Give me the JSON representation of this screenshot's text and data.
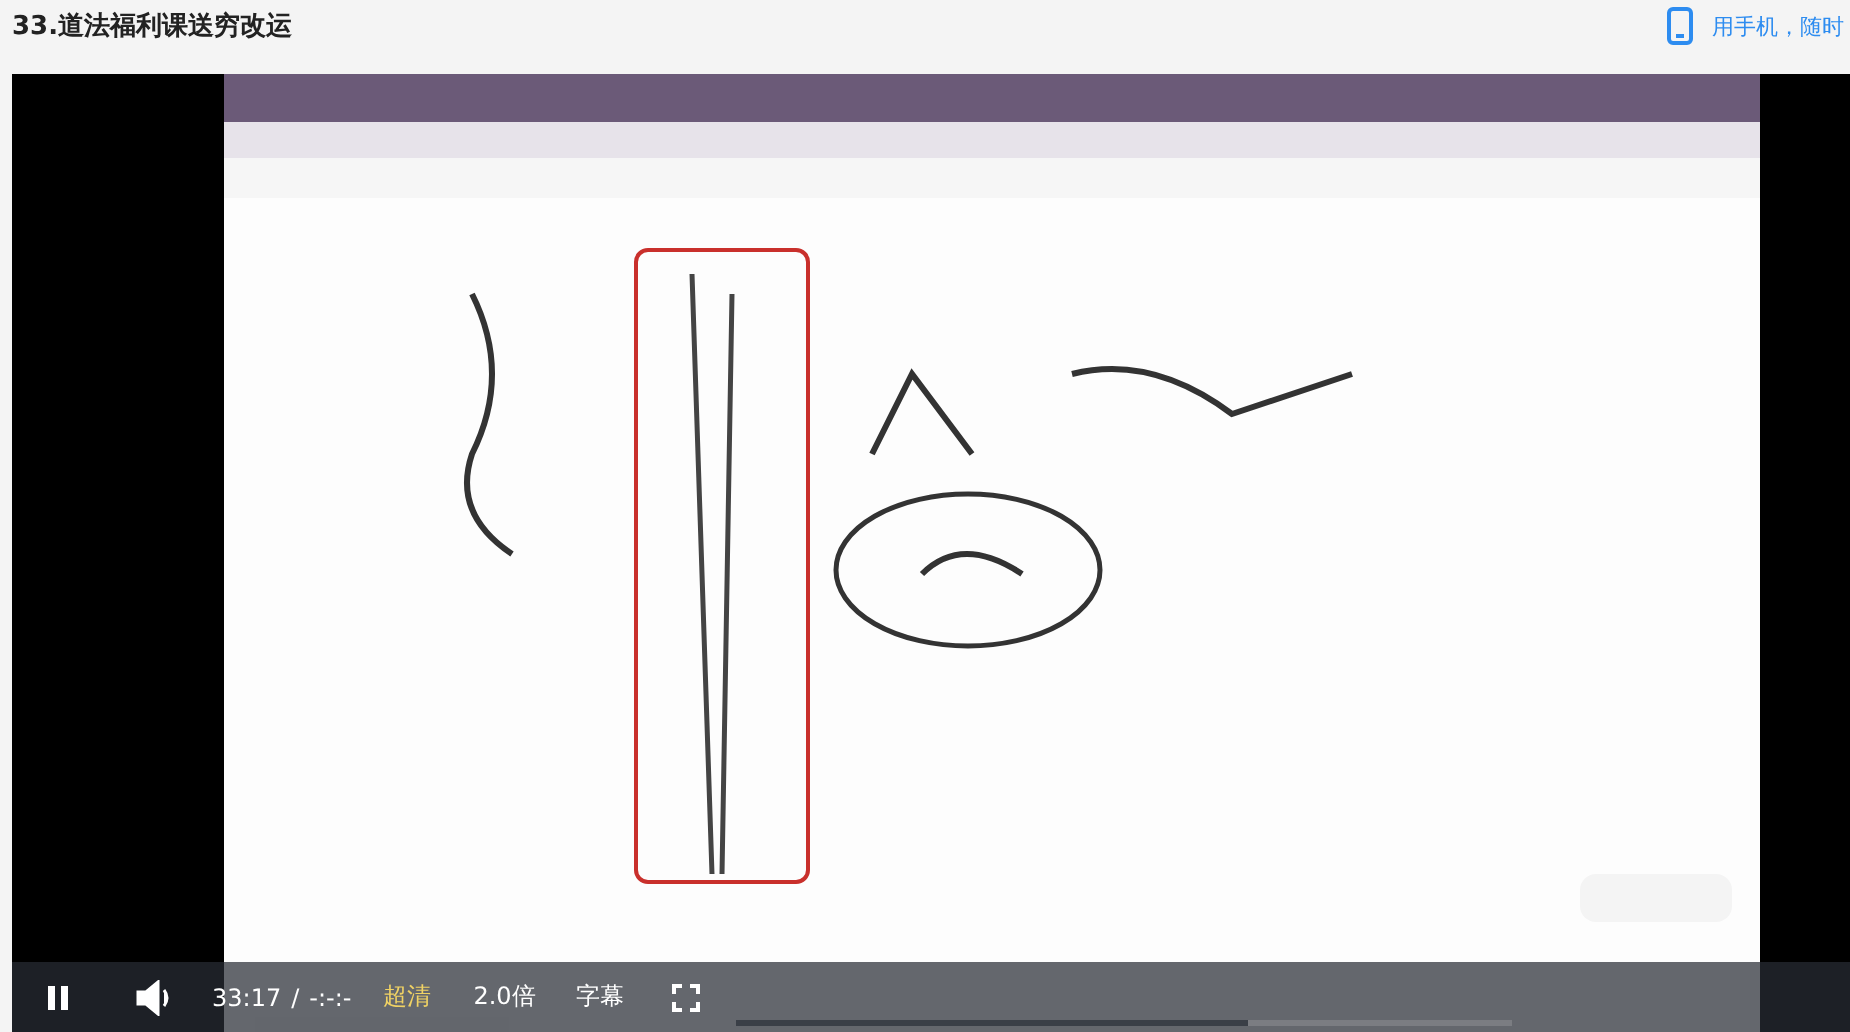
{
  "page": {
    "title": "33.道法福利课送穷改运",
    "mobile_link": "用手机，随时"
  },
  "player": {
    "playing": true,
    "time": "33:17",
    "separator": "/",
    "duration": "-:-:-",
    "quality": "超清",
    "speed": "2.0倍",
    "subtitles": "字幕",
    "progress": {
      "level": 0.66
    }
  }
}
